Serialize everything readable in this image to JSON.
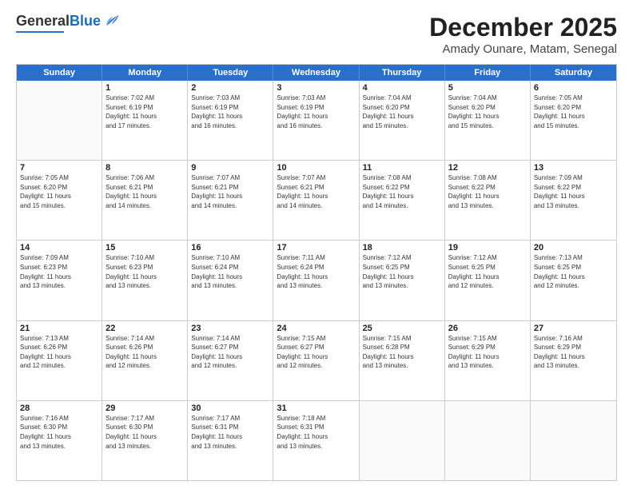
{
  "header": {
    "logo_general": "General",
    "logo_blue": "Blue",
    "main_title": "December 2025",
    "sub_title": "Amady Ounare, Matam, Senegal"
  },
  "days_of_week": [
    "Sunday",
    "Monday",
    "Tuesday",
    "Wednesday",
    "Thursday",
    "Friday",
    "Saturday"
  ],
  "weeks": [
    [
      {
        "day": "",
        "info": ""
      },
      {
        "day": "1",
        "info": "Sunrise: 7:02 AM\nSunset: 6:19 PM\nDaylight: 11 hours\nand 17 minutes."
      },
      {
        "day": "2",
        "info": "Sunrise: 7:03 AM\nSunset: 6:19 PM\nDaylight: 11 hours\nand 16 minutes."
      },
      {
        "day": "3",
        "info": "Sunrise: 7:03 AM\nSunset: 6:19 PM\nDaylight: 11 hours\nand 16 minutes."
      },
      {
        "day": "4",
        "info": "Sunrise: 7:04 AM\nSunset: 6:20 PM\nDaylight: 11 hours\nand 15 minutes."
      },
      {
        "day": "5",
        "info": "Sunrise: 7:04 AM\nSunset: 6:20 PM\nDaylight: 11 hours\nand 15 minutes."
      },
      {
        "day": "6",
        "info": "Sunrise: 7:05 AM\nSunset: 6:20 PM\nDaylight: 11 hours\nand 15 minutes."
      }
    ],
    [
      {
        "day": "7",
        "info": "Sunrise: 7:05 AM\nSunset: 6:20 PM\nDaylight: 11 hours\nand 15 minutes."
      },
      {
        "day": "8",
        "info": "Sunrise: 7:06 AM\nSunset: 6:21 PM\nDaylight: 11 hours\nand 14 minutes."
      },
      {
        "day": "9",
        "info": "Sunrise: 7:07 AM\nSunset: 6:21 PM\nDaylight: 11 hours\nand 14 minutes."
      },
      {
        "day": "10",
        "info": "Sunrise: 7:07 AM\nSunset: 6:21 PM\nDaylight: 11 hours\nand 14 minutes."
      },
      {
        "day": "11",
        "info": "Sunrise: 7:08 AM\nSunset: 6:22 PM\nDaylight: 11 hours\nand 14 minutes."
      },
      {
        "day": "12",
        "info": "Sunrise: 7:08 AM\nSunset: 6:22 PM\nDaylight: 11 hours\nand 13 minutes."
      },
      {
        "day": "13",
        "info": "Sunrise: 7:09 AM\nSunset: 6:22 PM\nDaylight: 11 hours\nand 13 minutes."
      }
    ],
    [
      {
        "day": "14",
        "info": "Sunrise: 7:09 AM\nSunset: 6:23 PM\nDaylight: 11 hours\nand 13 minutes."
      },
      {
        "day": "15",
        "info": "Sunrise: 7:10 AM\nSunset: 6:23 PM\nDaylight: 11 hours\nand 13 minutes."
      },
      {
        "day": "16",
        "info": "Sunrise: 7:10 AM\nSunset: 6:24 PM\nDaylight: 11 hours\nand 13 minutes."
      },
      {
        "day": "17",
        "info": "Sunrise: 7:11 AM\nSunset: 6:24 PM\nDaylight: 11 hours\nand 13 minutes."
      },
      {
        "day": "18",
        "info": "Sunrise: 7:12 AM\nSunset: 6:25 PM\nDaylight: 11 hours\nand 13 minutes."
      },
      {
        "day": "19",
        "info": "Sunrise: 7:12 AM\nSunset: 6:25 PM\nDaylight: 11 hours\nand 12 minutes."
      },
      {
        "day": "20",
        "info": "Sunrise: 7:13 AM\nSunset: 6:25 PM\nDaylight: 11 hours\nand 12 minutes."
      }
    ],
    [
      {
        "day": "21",
        "info": "Sunrise: 7:13 AM\nSunset: 6:26 PM\nDaylight: 11 hours\nand 12 minutes."
      },
      {
        "day": "22",
        "info": "Sunrise: 7:14 AM\nSunset: 6:26 PM\nDaylight: 11 hours\nand 12 minutes."
      },
      {
        "day": "23",
        "info": "Sunrise: 7:14 AM\nSunset: 6:27 PM\nDaylight: 11 hours\nand 12 minutes."
      },
      {
        "day": "24",
        "info": "Sunrise: 7:15 AM\nSunset: 6:27 PM\nDaylight: 11 hours\nand 12 minutes."
      },
      {
        "day": "25",
        "info": "Sunrise: 7:15 AM\nSunset: 6:28 PM\nDaylight: 11 hours\nand 13 minutes."
      },
      {
        "day": "26",
        "info": "Sunrise: 7:15 AM\nSunset: 6:29 PM\nDaylight: 11 hours\nand 13 minutes."
      },
      {
        "day": "27",
        "info": "Sunrise: 7:16 AM\nSunset: 6:29 PM\nDaylight: 11 hours\nand 13 minutes."
      }
    ],
    [
      {
        "day": "28",
        "info": "Sunrise: 7:16 AM\nSunset: 6:30 PM\nDaylight: 11 hours\nand 13 minutes."
      },
      {
        "day": "29",
        "info": "Sunrise: 7:17 AM\nSunset: 6:30 PM\nDaylight: 11 hours\nand 13 minutes."
      },
      {
        "day": "30",
        "info": "Sunrise: 7:17 AM\nSunset: 6:31 PM\nDaylight: 11 hours\nand 13 minutes."
      },
      {
        "day": "31",
        "info": "Sunrise: 7:18 AM\nSunset: 6:31 PM\nDaylight: 11 hours\nand 13 minutes."
      },
      {
        "day": "",
        "info": ""
      },
      {
        "day": "",
        "info": ""
      },
      {
        "day": "",
        "info": ""
      }
    ]
  ]
}
